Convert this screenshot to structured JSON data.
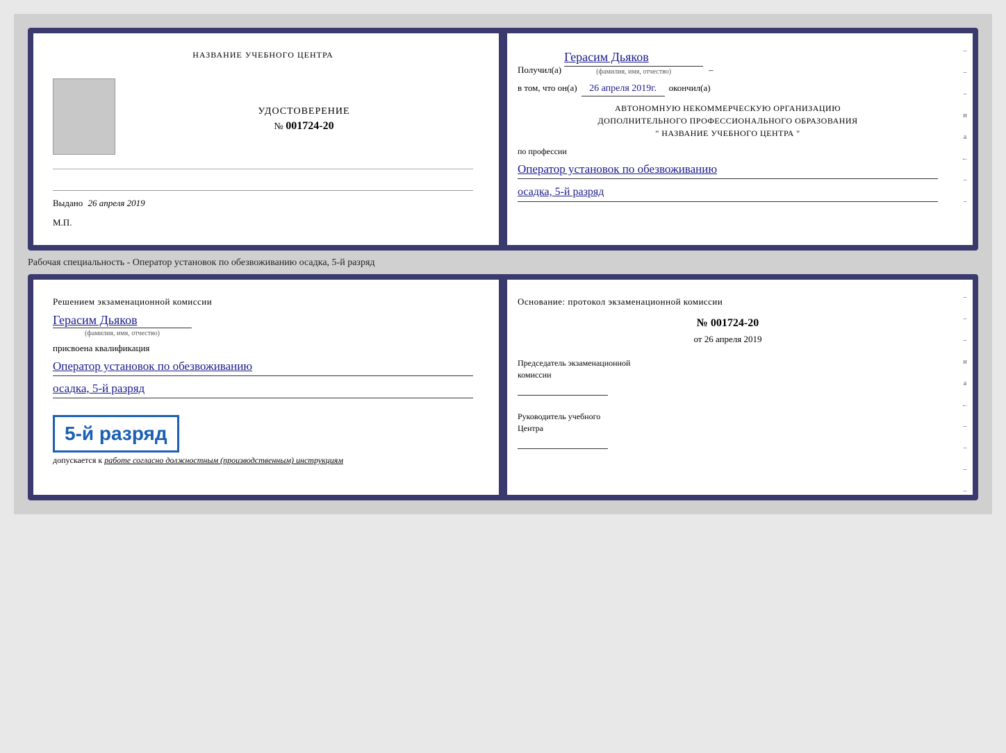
{
  "top_document": {
    "left": {
      "header": "НАЗВАНИЕ УЧЕБНОГО ЦЕНТРА",
      "udostoverenie_label": "УДОСТОВЕРЕНИЕ",
      "number_prefix": "№",
      "number": "001724-20",
      "vydano_label": "Выдано",
      "vydano_date": "26 апреля 2019",
      "mp_label": "М.П."
    },
    "right": {
      "poluchil_prefix": "Получил(а)",
      "poluchil_name": "Герасим Дьяков",
      "fio_sub": "(фамилия, имя, отчество)",
      "dash": "–",
      "vtom_prefix": "в том, что он(а)",
      "vtom_date": "26 апреля 2019г.",
      "vtom_suffix": "окончил(а)",
      "org_line1": "АВТОНОМНУЮ НЕКОММЕРЧЕСКУЮ ОРГАНИЗАЦИЮ",
      "org_line2": "ДОПОЛНИТЕЛЬНОГО ПРОФЕССИОНАЛЬНОГО ОБРАЗОВАНИЯ",
      "org_line3": "\"   НАЗВАНИЕ УЧЕБНОГО ЦЕНТРА   \"",
      "po_professii": "по профессии",
      "profession": "Оператор установок по обезвоживанию",
      "razryad": "осадка, 5-й разряд"
    }
  },
  "separator": {
    "text": "Рабочая специальность - Оператор установок по обезвоживанию осадка, 5-й разряд"
  },
  "bottom_document": {
    "left": {
      "resheniem": "Решением экзаменационной комиссии",
      "fio": "Герасим Дьяков",
      "fio_sub": "(фамилия, имя, отчество)",
      "prisvoena": "присвоена квалификация",
      "kvalif1": "Оператор установок по обезвоживанию",
      "kvalif2": "осадка, 5-й разряд",
      "stamp_text": "5-й разряд",
      "dopuskaetsya_prefix": "допускается к",
      "dopuskaetsya_suffix": "работе согласно должностным (производственным) инструкциям"
    },
    "right": {
      "osnovanie": "Основание: протокол экзаменационной комиссии",
      "number_prefix": "№",
      "number": "001724-20",
      "ot_prefix": "от",
      "ot_date": "26 апреля 2019",
      "predsedatel_line1": "Председатель экзаменационной",
      "predsedatel_line2": "комиссии",
      "rukov_line1": "Руководитель учебного",
      "rukov_line2": "Центра"
    }
  },
  "right_marks": {
    "marks": [
      "–",
      "–",
      "–",
      "и",
      "а",
      "←",
      "–",
      "–",
      "–",
      "–"
    ]
  }
}
